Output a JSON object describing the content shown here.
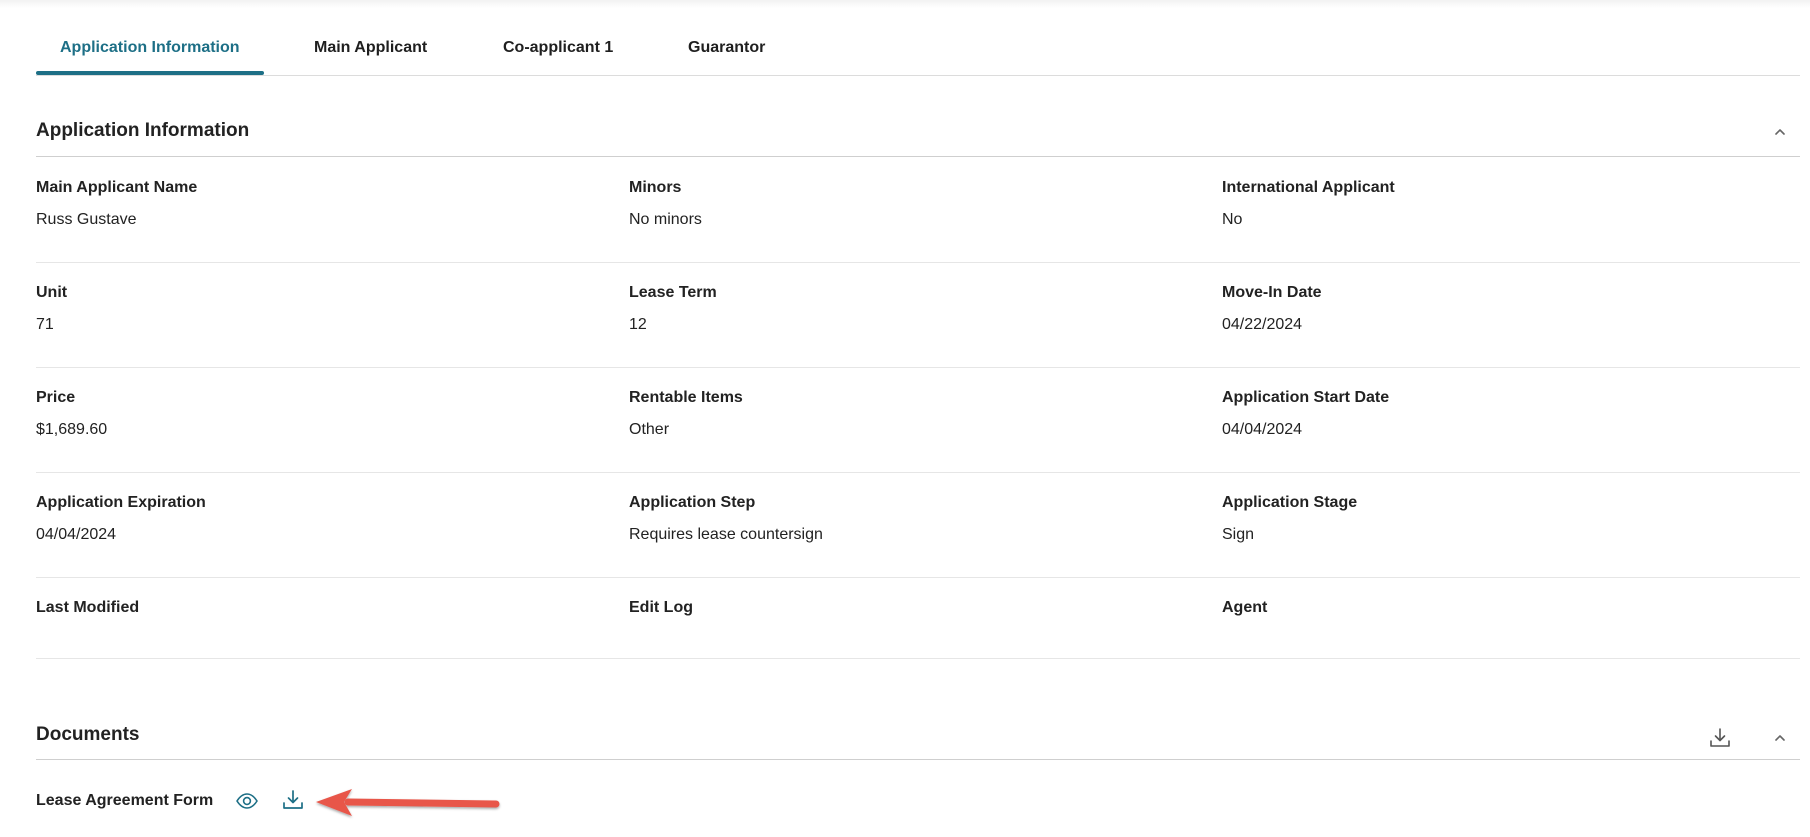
{
  "tabs": [
    {
      "label": "Application Information",
      "active": true
    },
    {
      "label": "Main Applicant",
      "active": false
    },
    {
      "label": "Co-applicant 1",
      "active": false
    },
    {
      "label": "Guarantor",
      "active": false
    }
  ],
  "application_info": {
    "title": "Application Information",
    "rows": [
      [
        {
          "label": "Main Applicant Name",
          "value": "Russ Gustave"
        },
        {
          "label": "Minors",
          "value": "No minors"
        },
        {
          "label": "International Applicant",
          "value": "No"
        }
      ],
      [
        {
          "label": "Unit",
          "value": "71"
        },
        {
          "label": "Lease Term",
          "value": "12"
        },
        {
          "label": "Move-In Date",
          "value": "04/22/2024"
        }
      ],
      [
        {
          "label": "Price",
          "value": "$1,689.60"
        },
        {
          "label": "Rentable Items",
          "value": "Other"
        },
        {
          "label": "Application Start Date",
          "value": "04/04/2024"
        }
      ],
      [
        {
          "label": "Application Expiration",
          "value": "04/04/2024"
        },
        {
          "label": "Application Step",
          "value": "Requires lease countersign"
        },
        {
          "label": "Application Stage",
          "value": "Sign"
        }
      ],
      [
        {
          "label": "Last Modified",
          "value": ""
        },
        {
          "label": "Edit Log",
          "value": ""
        },
        {
          "label": "Agent",
          "value": ""
        }
      ]
    ]
  },
  "documents": {
    "title": "Documents",
    "items": [
      {
        "label": "Lease Agreement Form"
      }
    ]
  },
  "icons": {
    "collapse": "chevron-up-icon",
    "download": "download-icon",
    "view": "eye-icon",
    "annotation": "red-arrow"
  },
  "colors": {
    "accent": "#1d6f86",
    "annotation_arrow": "#e8574a"
  }
}
